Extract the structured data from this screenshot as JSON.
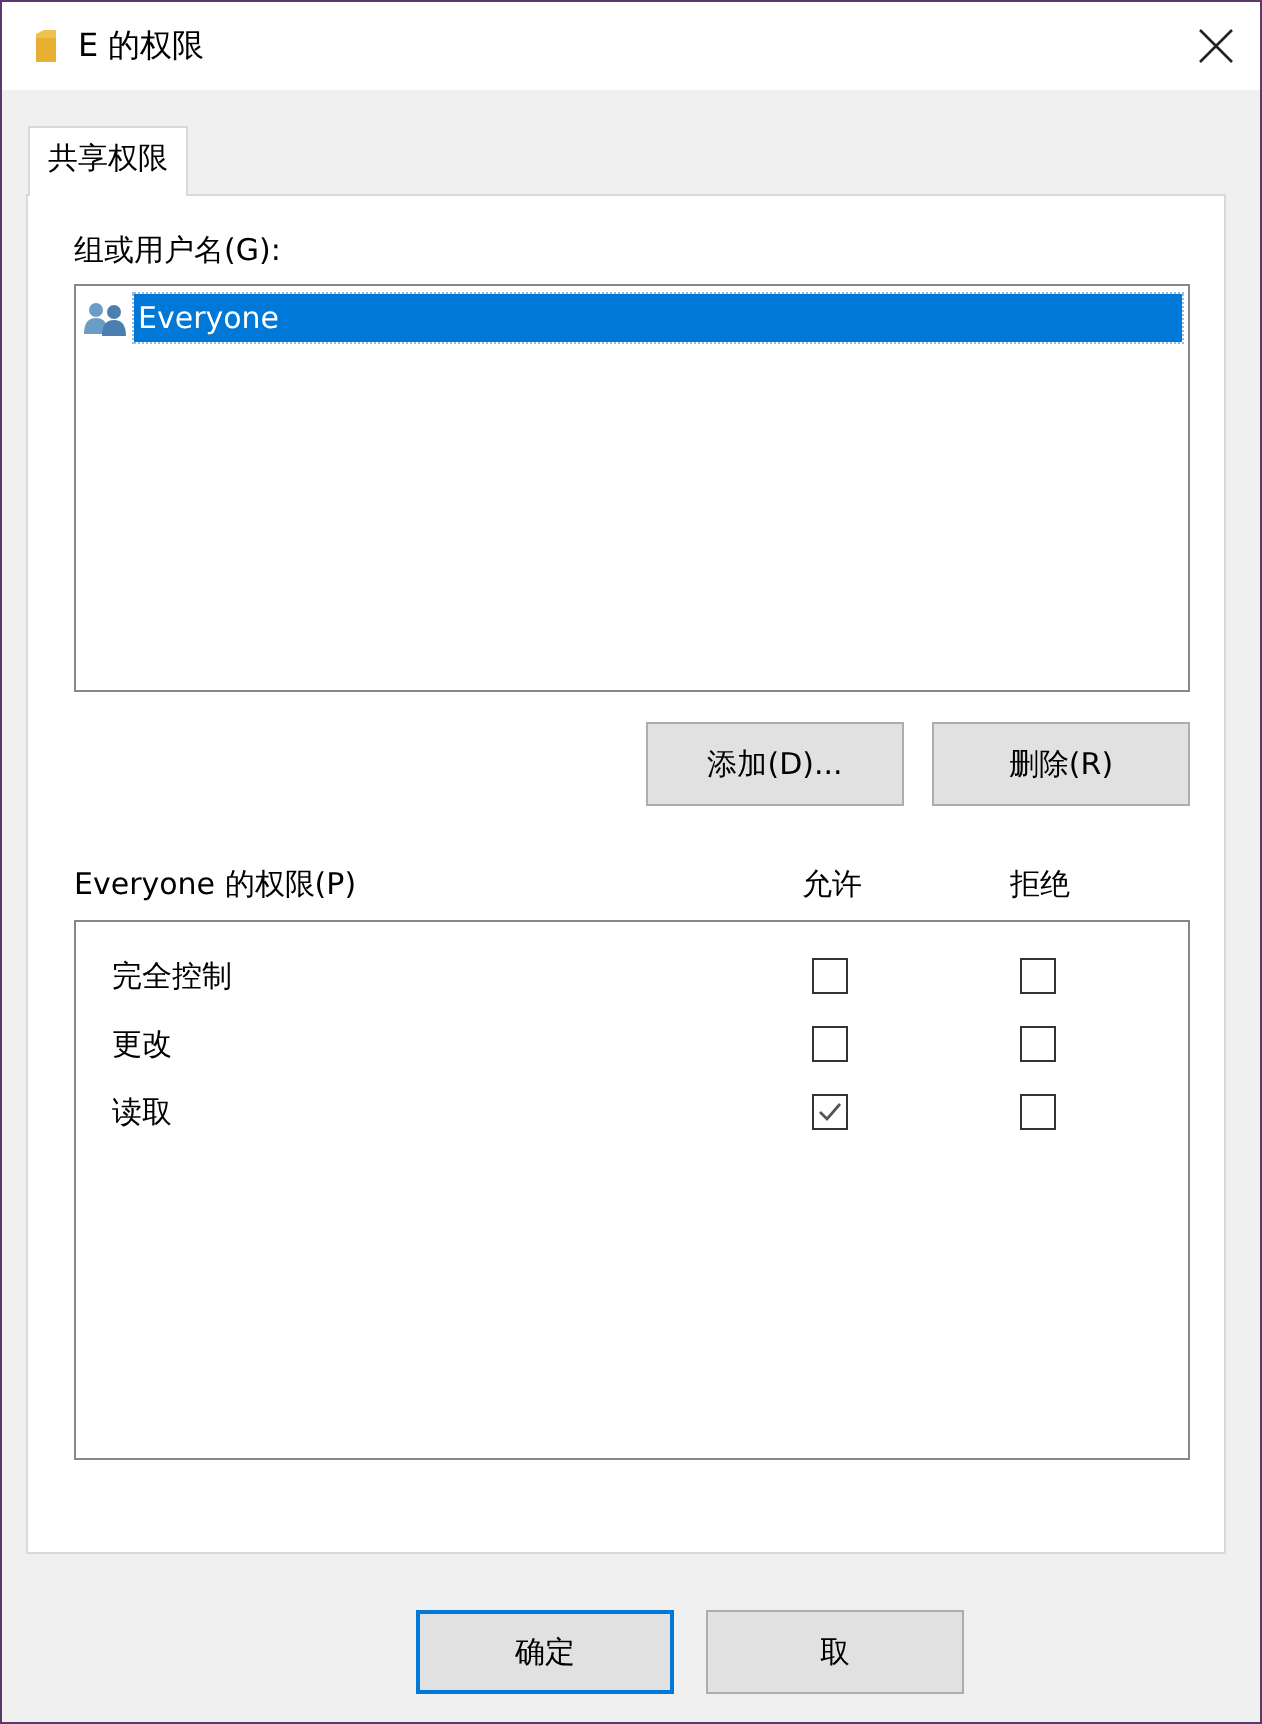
{
  "window": {
    "title": "E 的权限"
  },
  "tabs": [
    {
      "label": "共享权限",
      "selected": true
    }
  ],
  "groups": {
    "label": "组或用户名(G):",
    "items": [
      {
        "name": "Everyone",
        "selected": true
      }
    ]
  },
  "group_buttons": [
    "添加(D)...",
    "删除(R)"
  ],
  "permissions": {
    "label": "Everyone 的权限(P)",
    "columns": [
      "允许",
      "拒绝"
    ],
    "rows": [
      {
        "name": "完全控制",
        "allow": false,
        "deny": false
      },
      {
        "name": "更改",
        "allow": false,
        "deny": false
      },
      {
        "name": "读取",
        "allow": true,
        "deny": false
      }
    ]
  },
  "buttons": [
    {
      "label": "确定",
      "default": true
    },
    {
      "label": "取",
      "default": false
    }
  ]
}
